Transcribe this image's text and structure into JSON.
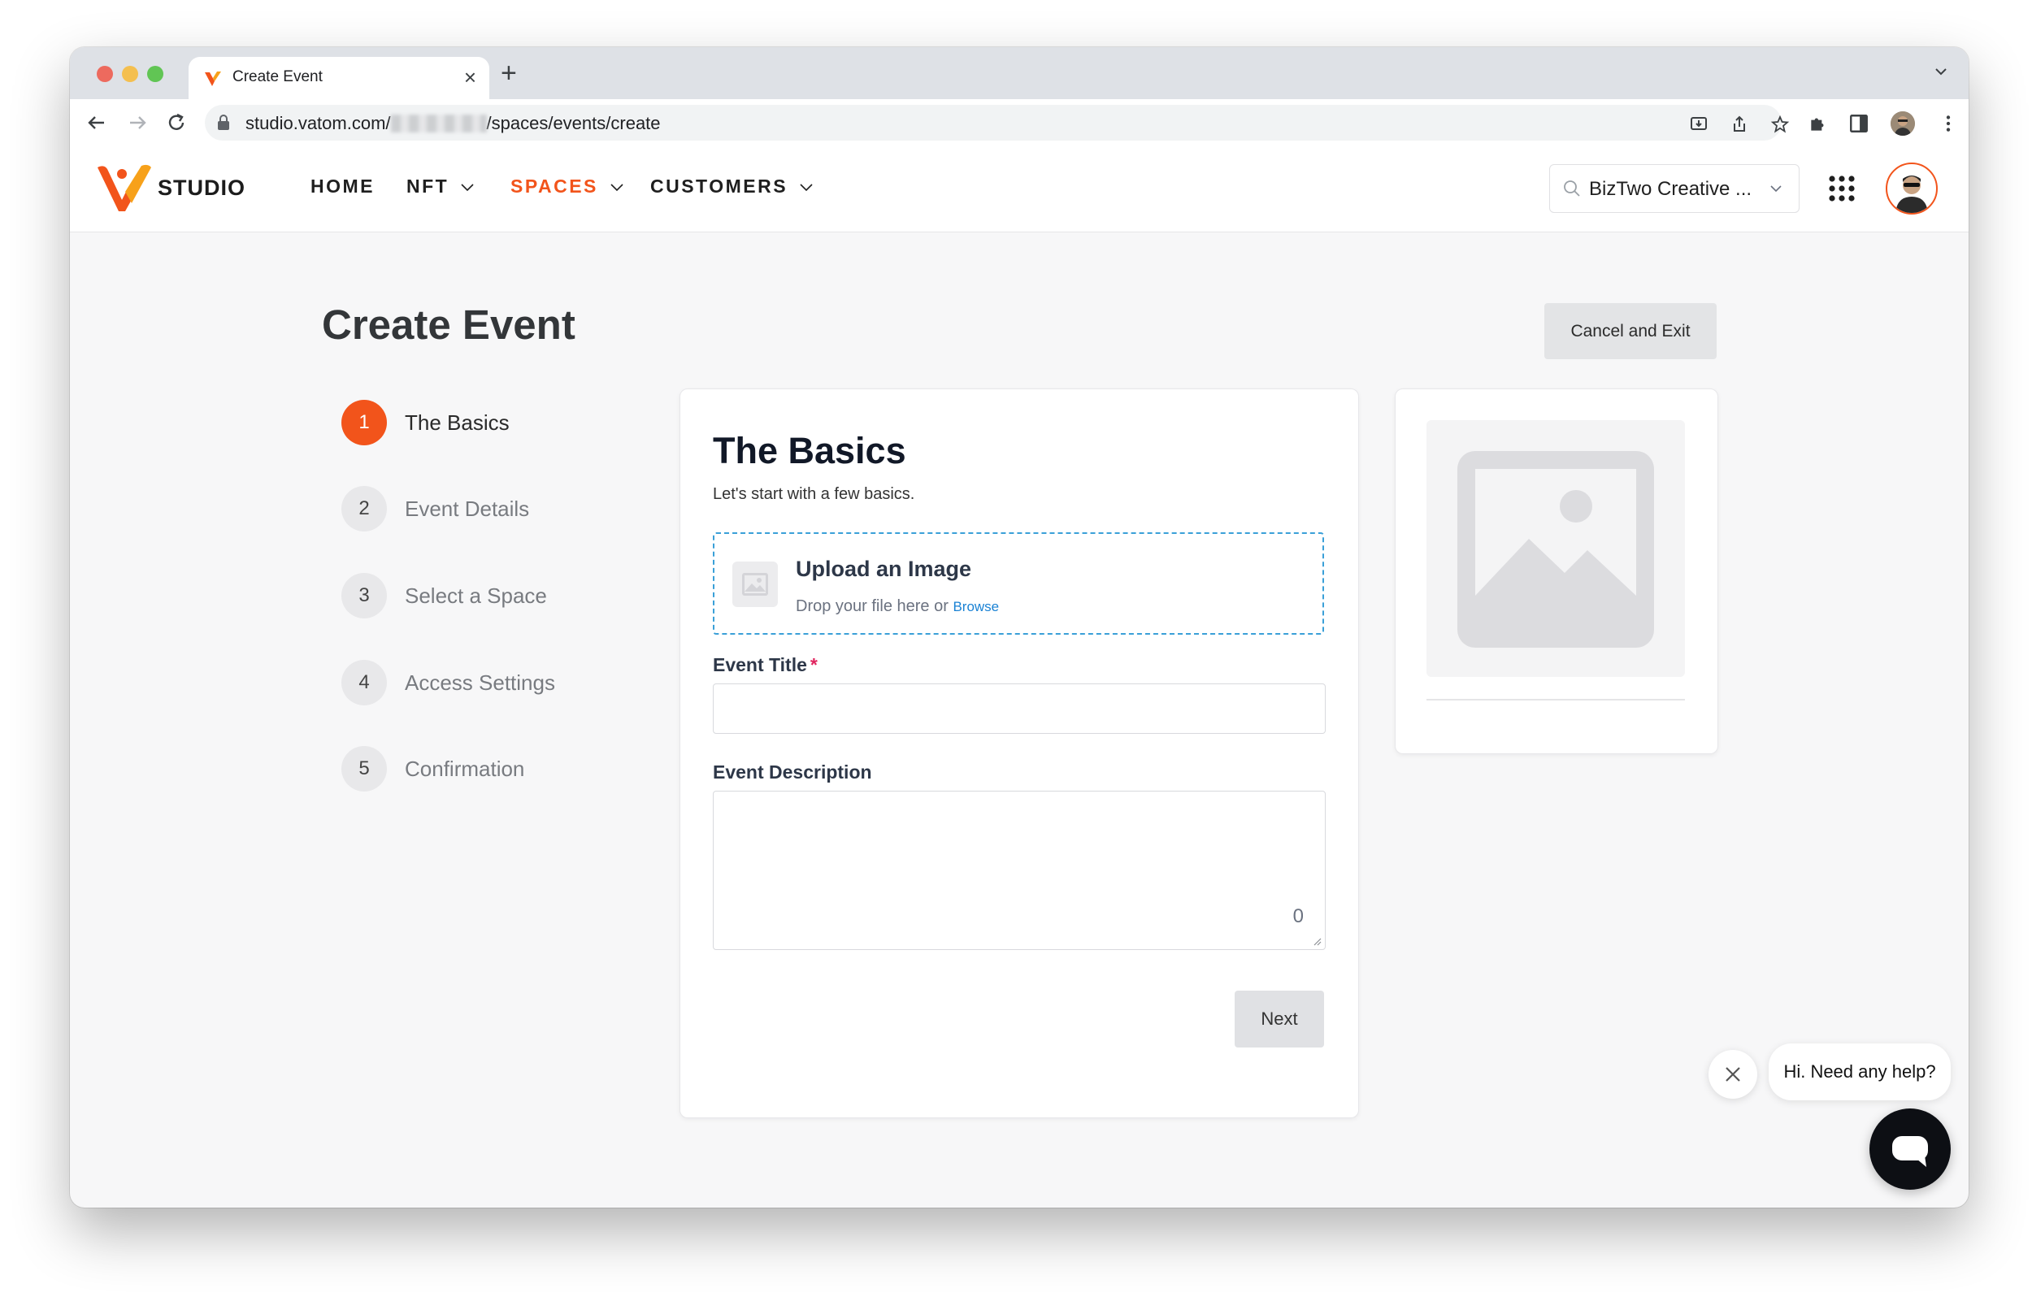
{
  "browser": {
    "tab_title": "Create Event",
    "url_prefix": "studio.vatom.com/",
    "url_suffix": "/spaces/events/create"
  },
  "app": {
    "logo_text": "STUDIO",
    "nav": [
      {
        "label": "HOME",
        "has_dropdown": false,
        "active": false
      },
      {
        "label": "NFT",
        "has_dropdown": true,
        "active": false
      },
      {
        "label": "SPACES",
        "has_dropdown": true,
        "active": true
      },
      {
        "label": "CUSTOMERS",
        "has_dropdown": true,
        "active": false
      }
    ],
    "org_selector": "BizTwo Creative ...",
    "accent_color": "#f2541b"
  },
  "page": {
    "title": "Create Event",
    "cancel_label": "Cancel and Exit"
  },
  "steps": [
    {
      "number": "1",
      "label": "The Basics",
      "active": true
    },
    {
      "number": "2",
      "label": "Event Details",
      "active": false
    },
    {
      "number": "3",
      "label": "Select a Space",
      "active": false
    },
    {
      "number": "4",
      "label": "Access Settings",
      "active": false
    },
    {
      "number": "5",
      "label": "Confirmation",
      "active": false
    }
  ],
  "form": {
    "heading": "The Basics",
    "subheading": "Let's start with a few basics.",
    "upload_title": "Upload an Image",
    "upload_hint": "Drop your file here or",
    "upload_browse": "Browse",
    "title_label": "Event Title",
    "title_required_mark": "*",
    "title_value": "",
    "description_label": "Event Description",
    "description_value": "",
    "description_char_count": "0",
    "next_label": "Next"
  },
  "help": {
    "bubble_text": "Hi. Need any help?"
  }
}
